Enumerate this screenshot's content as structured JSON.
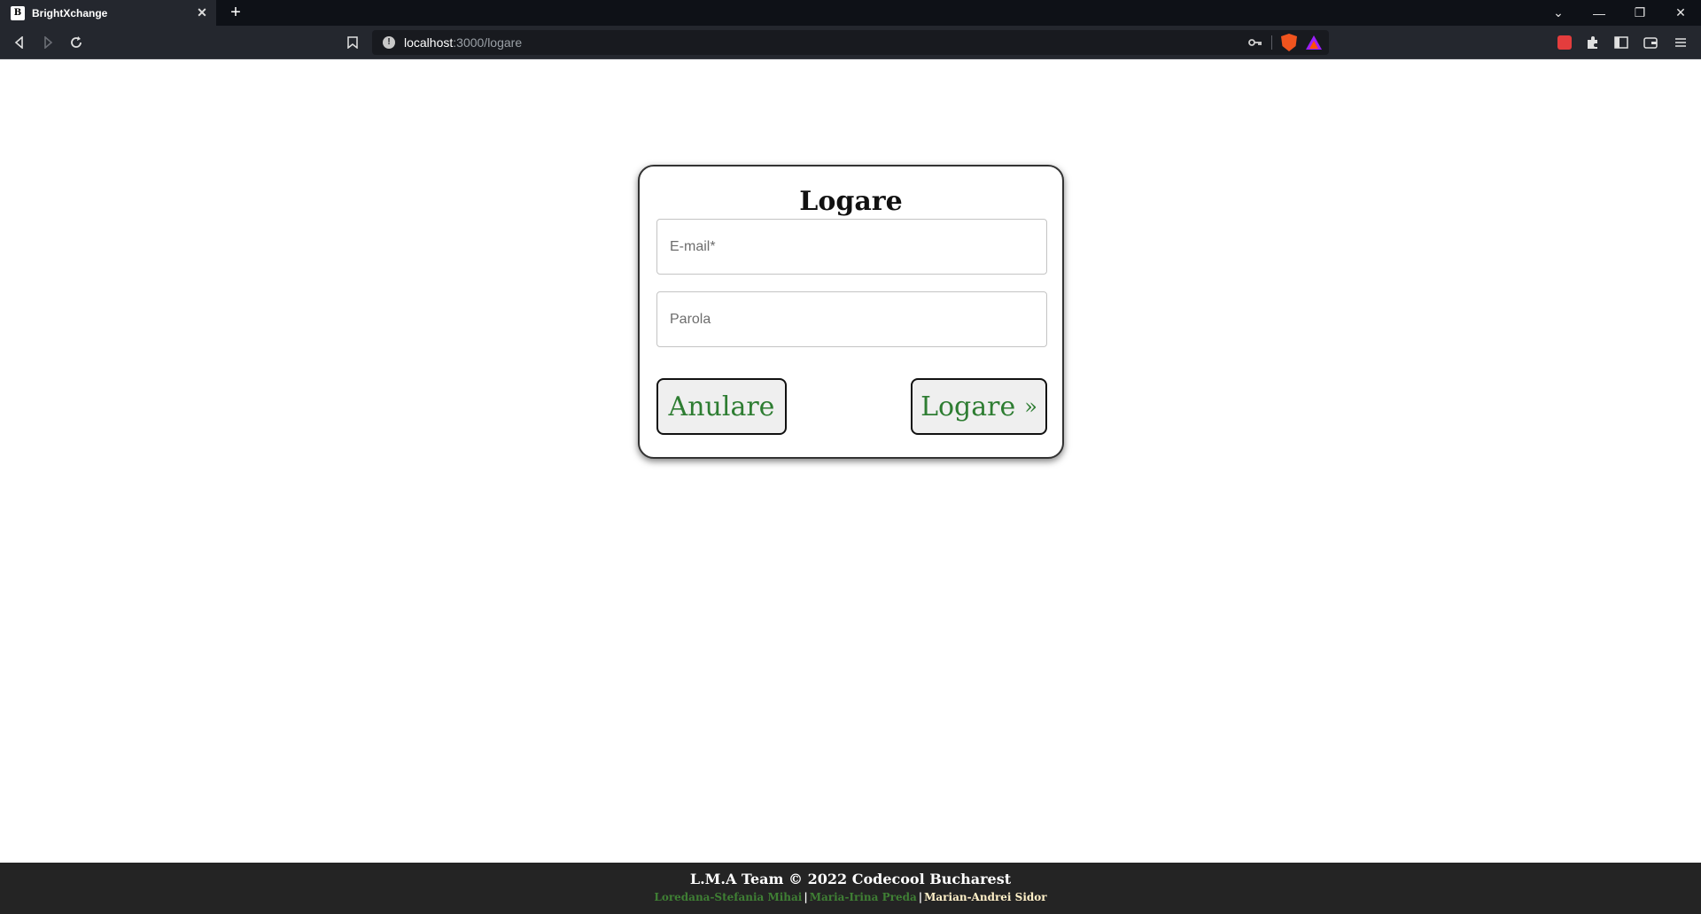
{
  "browser": {
    "tab_title": "BrightXchange",
    "tab_close": "✕",
    "new_tab": "+",
    "url_host": "localhost",
    "url_path": ":3000/logare",
    "window_controls": [
      "⌄",
      "—",
      "❐",
      "✕"
    ]
  },
  "login": {
    "title": "Logare",
    "email_placeholder": "E-mail*",
    "password_placeholder": "Parola",
    "cancel_label": "Anulare",
    "submit_label": "Logare",
    "submit_arrow": "»"
  },
  "footer": {
    "title": "L.M.A Team © 2022 Codecool Bucharest",
    "names": [
      "Loredana-Stefania Mihai",
      "Maria-Irina Preda",
      "Marian-Andrei Sidor"
    ],
    "separator": "|"
  },
  "colors": {
    "accent_green": "#2e7d32",
    "footer_bg": "#242424",
    "browser_bg": "#24272e"
  }
}
